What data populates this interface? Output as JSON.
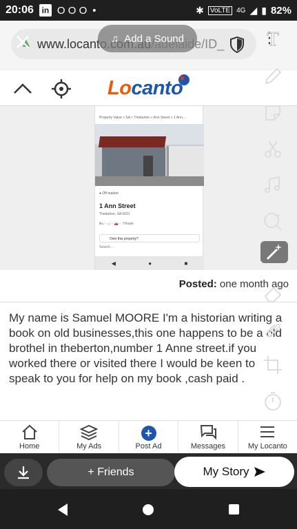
{
  "status_bar": {
    "time": "20:06",
    "linkedin_label": "in",
    "notif_icons": "O O O",
    "dot": "•",
    "volte": "VoLTE",
    "network": "4G",
    "battery": "82%"
  },
  "browser": {
    "url_domain": "www.locanto.com.au",
    "url_path": "/adelaide/ID_",
    "add_sound_label": "Add a Sound"
  },
  "site": {
    "logo_part1": "Lo",
    "logo_part2": "canto"
  },
  "listing_preview": {
    "breadcrumb": "Property Value  >  SA  >  Thebarton  >  Ann Street  >  1 Ann...",
    "off_market": "● Off market",
    "address": "1 Ann Street",
    "suburb": "Thebarton, SA 5031",
    "features": "🛏 -  🛁 -  🚗 -  ·  House",
    "own_property": "Own this property?",
    "search_placeholder": "Search..."
  },
  "posted": {
    "label": "Posted:",
    "value": "one month ago"
  },
  "description": "My name is Samuel MOORE I'm a historian writing a book on old businesses,this one happens to be a old brothel in theberton,number 1 Anne street.if you worked there or visited there I would be keen to speak to you for help on my book ,cash paid .",
  "locanto_nav": [
    {
      "label": "Home",
      "icon": "home-icon"
    },
    {
      "label": "My Ads",
      "icon": "stack-icon"
    },
    {
      "label": "Post Ad",
      "icon": "plus-icon"
    },
    {
      "label": "Messages",
      "icon": "chat-icon"
    },
    {
      "label": "My Locanto",
      "icon": "hamburger-icon"
    }
  ],
  "snap_bar": {
    "friends_label": "+ Friends",
    "story_label": "My Story"
  }
}
